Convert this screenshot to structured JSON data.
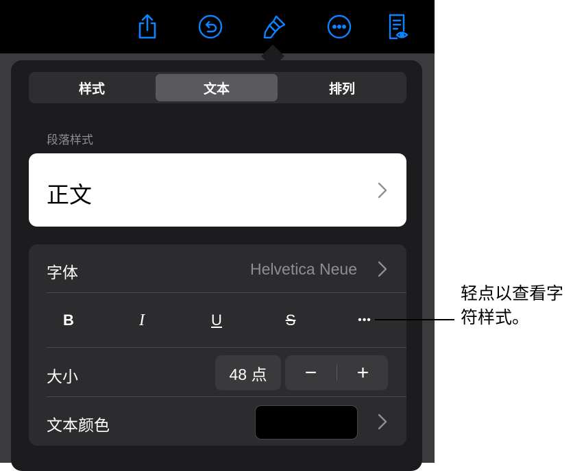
{
  "toolbar": {
    "icons": [
      "share-icon",
      "undo-icon",
      "format-brush-icon",
      "more-icon",
      "document-view-icon"
    ],
    "accent_color": "#0a84ff"
  },
  "tabs": [
    {
      "label": "样式",
      "active": false
    },
    {
      "label": "文本",
      "active": true
    },
    {
      "label": "排列",
      "active": false
    }
  ],
  "paragraph_style": {
    "section_label": "段落样式",
    "value": "正文"
  },
  "font": {
    "label": "字体",
    "value": "Helvetica Neue"
  },
  "style_buttons": {
    "bold": "B",
    "italic": "I",
    "underline": "U",
    "strikethrough": "S",
    "more": "•••"
  },
  "size": {
    "label": "大小",
    "value": "48 点",
    "minus": "−",
    "plus": "+"
  },
  "text_color": {
    "label": "文本颜色",
    "color": "#000000"
  },
  "callout": {
    "text": "轻点以查看字符样式。"
  }
}
